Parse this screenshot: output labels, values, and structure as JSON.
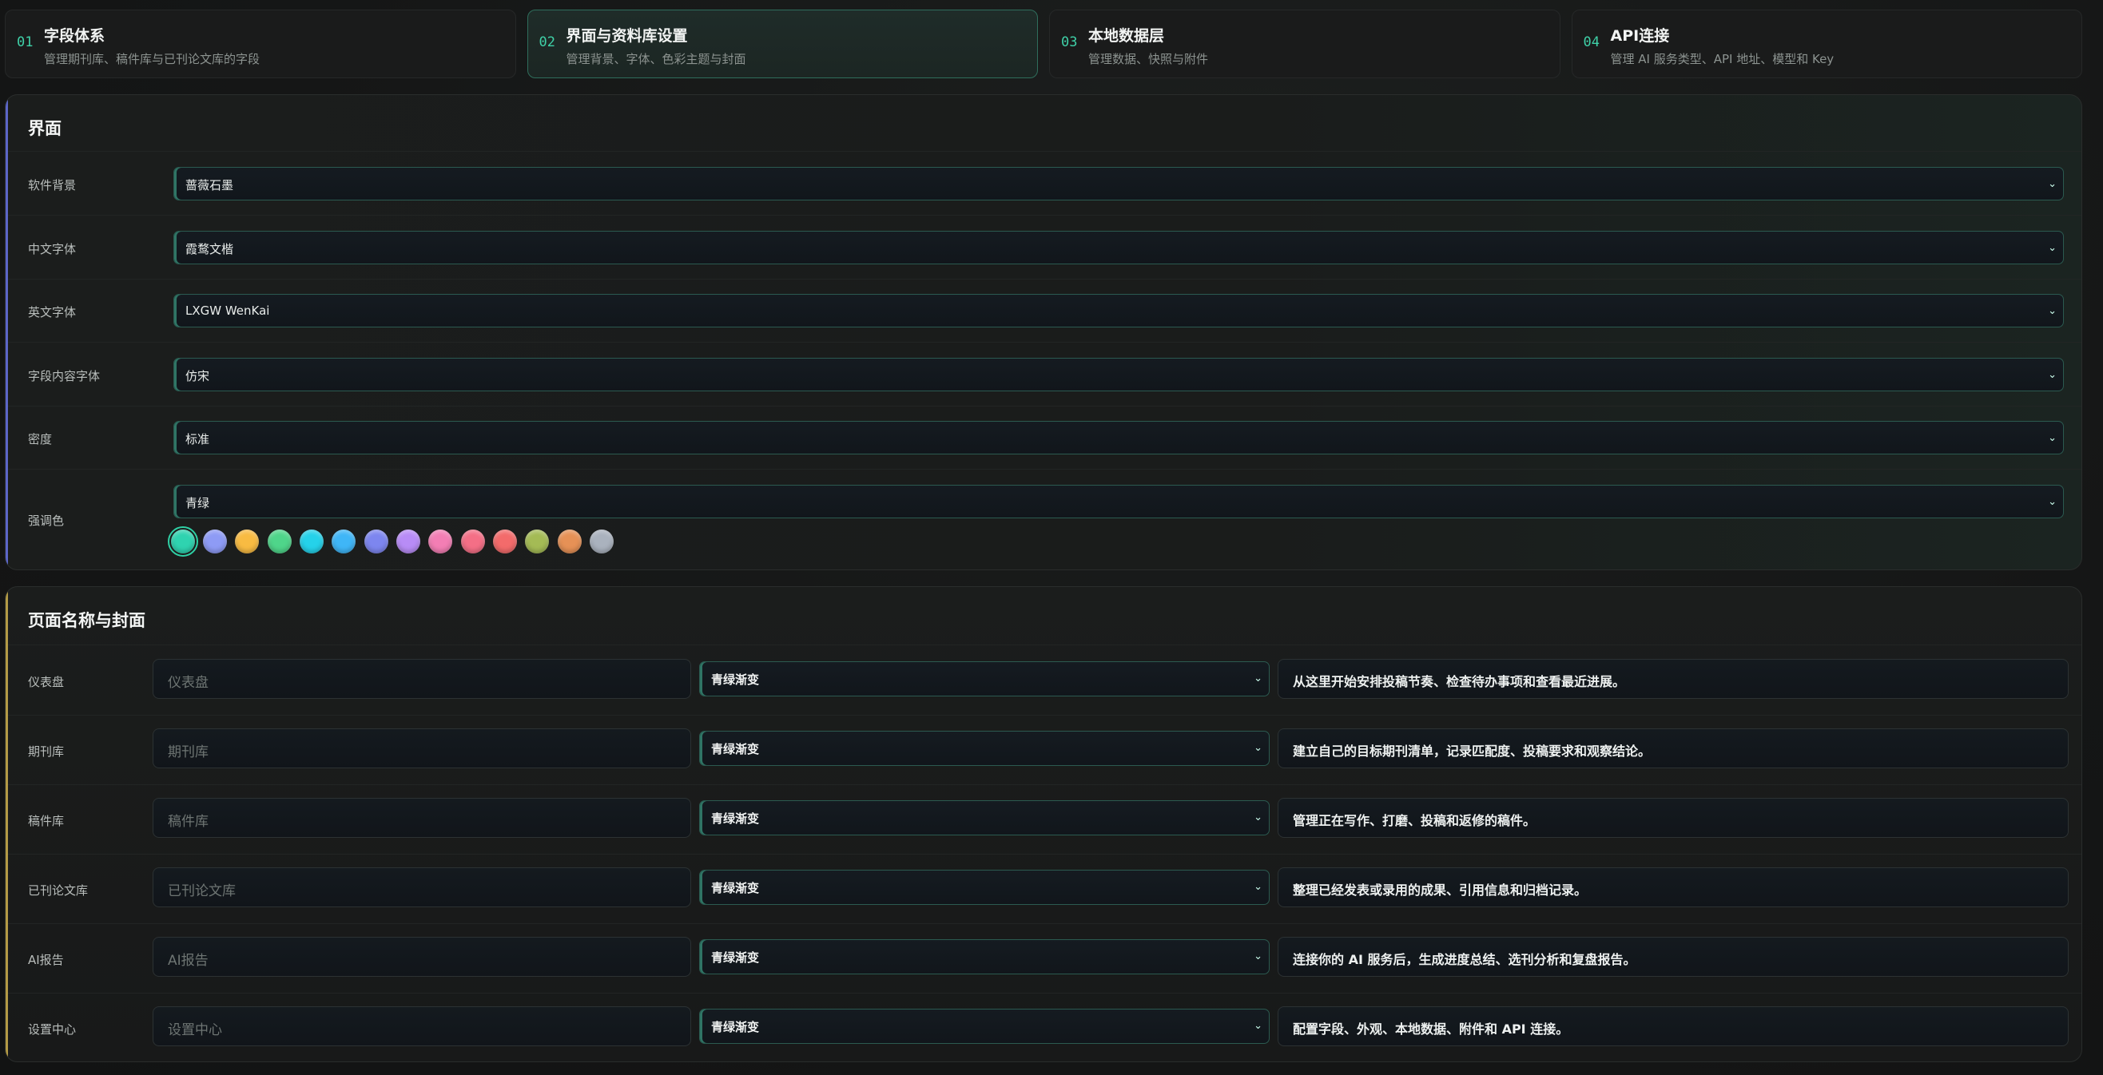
{
  "steps": [
    {
      "num": "01",
      "title": "字段体系",
      "sub": "管理期刊库、稿件库与已刊论文库的字段"
    },
    {
      "num": "02",
      "title": "界面与资料库设置",
      "sub": "管理背景、字体、色彩主题与封面"
    },
    {
      "num": "03",
      "title": "本地数据层",
      "sub": "管理数据、快照与附件"
    },
    {
      "num": "04",
      "title": "API连接",
      "sub": "管理 AI 服务类型、API 地址、模型和 Key"
    }
  ],
  "interface": {
    "title": "界面",
    "rows": [
      {
        "label": "软件背景",
        "value": "蔷薇石墨"
      },
      {
        "label": "中文字体",
        "value": "霞鹜文楷"
      },
      {
        "label": "英文字体",
        "value": "LXGW WenKai"
      },
      {
        "label": "字段内容字体",
        "value": "仿宋"
      },
      {
        "label": "密度",
        "value": "标准"
      },
      {
        "label": "强调色",
        "value": "青绿"
      }
    ],
    "accent_colors": [
      "#2fd3b0",
      "#8e9bf5",
      "#f8bb42",
      "#4fd58a",
      "#25d2ea",
      "#3fb6f7",
      "#7d86ef",
      "#b88cf6",
      "#f37eb4",
      "#f46f86",
      "#f36b6b",
      "#a4bb55",
      "#e69156",
      "#aab2be"
    ]
  },
  "pages": {
    "title": "页面名称与封面",
    "rows": [
      {
        "label": "仪表盘",
        "placeholder": "仪表盘",
        "cover": "青绿渐变",
        "desc": "从这里开始安排投稿节奏、检查待办事项和查看最近进展。"
      },
      {
        "label": "期刊库",
        "placeholder": "期刊库",
        "cover": "青绿渐变",
        "desc": "建立自己的目标期刊清单，记录匹配度、投稿要求和观察结论。"
      },
      {
        "label": "稿件库",
        "placeholder": "稿件库",
        "cover": "青绿渐变",
        "desc": "管理正在写作、打磨、投稿和返修的稿件。"
      },
      {
        "label": "已刊论文库",
        "placeholder": "已刊论文库",
        "cover": "青绿渐变",
        "desc": "整理已经发表或录用的成果、引用信息和归档记录。"
      },
      {
        "label": "AI报告",
        "placeholder": "AI报告",
        "cover": "青绿渐变",
        "desc": "连接你的 AI 服务后，生成进度总结、选刊分析和复盘报告。"
      },
      {
        "label": "设置中心",
        "placeholder": "设置中心",
        "cover": "青绿渐变",
        "desc": "配置字段、外观、本地数据、附件和 API 连接。"
      }
    ]
  },
  "colors": {
    "accent": "#2fd3b0",
    "panel_edge_interface": "#5c66c8",
    "panel_edge_pages": "#b39a45"
  }
}
